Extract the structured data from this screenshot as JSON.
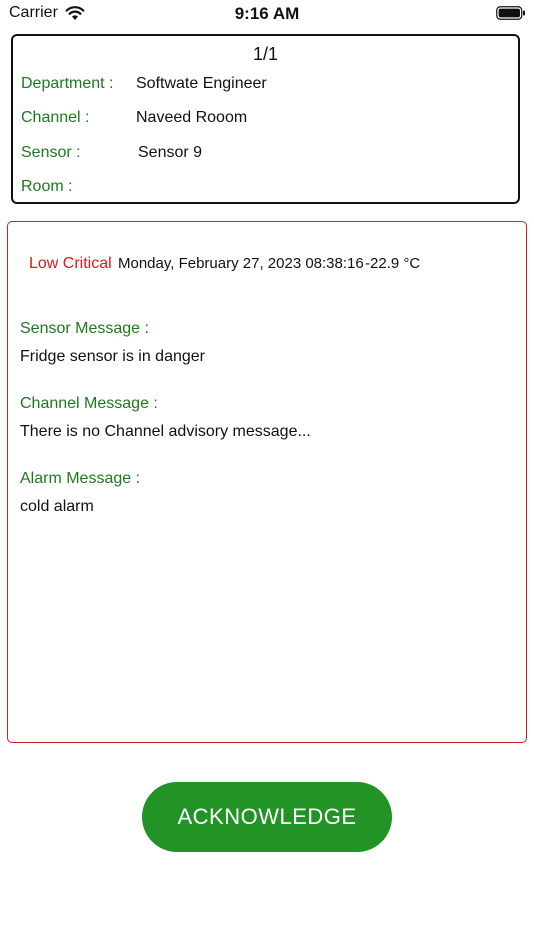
{
  "status_bar": {
    "carrier": "Carrier",
    "time": "9:16 AM",
    "icons": [
      "wifi-icon",
      "battery-icon"
    ]
  },
  "info_card": {
    "pager": "1/1",
    "rows": [
      {
        "label": "Department :",
        "value": "Softwate Engineer"
      },
      {
        "label": "Channel :",
        "value": "Naveed Rooom"
      },
      {
        "label": "Sensor :",
        "value": "Sensor 9"
      },
      {
        "label": "Room  :",
        "value": ""
      }
    ]
  },
  "alert": {
    "severity": "Low Critical",
    "timestamp": "Monday, February 27, 2023 08:38:16",
    "temperature": "-22.9 °C",
    "messages": [
      {
        "label": "Sensor Message :",
        "text": "Fridge sensor is in danger"
      },
      {
        "label": "Channel Message :",
        "text": "There is no Channel advisory message..."
      },
      {
        "label": "Alarm Message :",
        "text": "cold alarm"
      }
    ]
  },
  "actions": {
    "acknowledge_label": "ACKNOWLEDGE"
  },
  "colors": {
    "label_green": "#1f7a1f",
    "critical_red": "#e01818",
    "button_green": "#229426"
  }
}
